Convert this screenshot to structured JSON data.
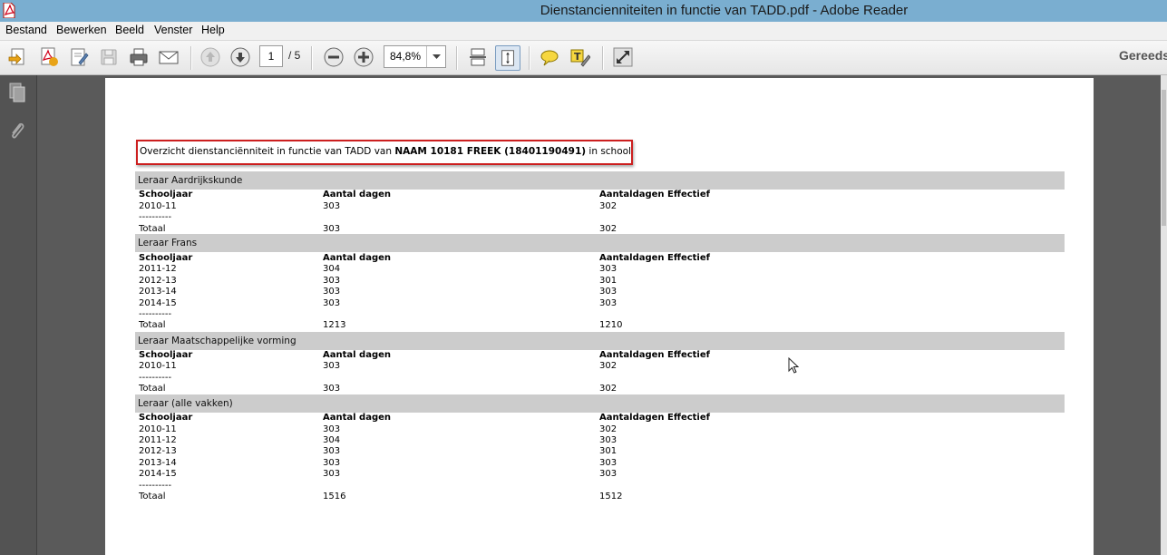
{
  "window": {
    "title": "Dienstancienniteiten in functie van TADD.pdf - Adobe Reader"
  },
  "menu": [
    "Bestand",
    "Bewerken",
    "Beeld",
    "Venster",
    "Help"
  ],
  "toolbar": {
    "page_current": "1",
    "page_total": "/ 5",
    "zoom": "84,8%",
    "status": "Gereeds"
  },
  "document": {
    "overview_prefix": "Overzicht dienstanciënniteit in functie van TADD van",
    "overview_name": "NAAM 10181 FREEK (18401190491)",
    "overview_suffix": "in school",
    "columns": [
      "Schooljaar",
      "Aantal dagen",
      "Aantaldagen Effectief"
    ],
    "separator": "----------",
    "total_label": "Totaal",
    "sections": [
      {
        "title": "Leraar Aardrijkskunde",
        "rows": [
          [
            "2010-11",
            "303",
            "302"
          ]
        ],
        "total": [
          "303",
          "302"
        ]
      },
      {
        "title": "Leraar Frans",
        "rows": [
          [
            "2011-12",
            "304",
            "303"
          ],
          [
            "2012-13",
            "303",
            "301"
          ],
          [
            "2013-14",
            "303",
            "303"
          ],
          [
            "2014-15",
            "303",
            "303"
          ]
        ],
        "total": [
          "1213",
          "1210"
        ]
      },
      {
        "title": "Leraar Maatschappelijke vorming",
        "rows": [
          [
            "2010-11",
            "303",
            "302"
          ]
        ],
        "total": [
          "303",
          "302"
        ]
      },
      {
        "title": "Leraar (alle vakken)",
        "rows": [
          [
            "2010-11",
            "303",
            "302"
          ],
          [
            "2011-12",
            "304",
            "303"
          ],
          [
            "2012-13",
            "303",
            "301"
          ],
          [
            "2013-14",
            "303",
            "303"
          ],
          [
            "2014-15",
            "303",
            "303"
          ]
        ],
        "total": [
          "1516",
          "1512"
        ]
      }
    ]
  }
}
